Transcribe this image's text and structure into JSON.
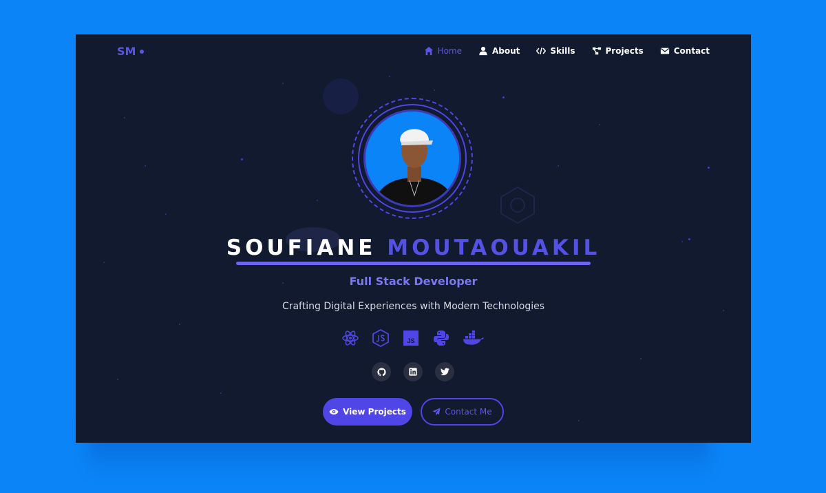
{
  "colors": {
    "page_bg": "#0a84f6",
    "frame_bg": "#111a2e",
    "accent": "#4f46e5",
    "accent_light": "#7c78f0"
  },
  "logo": {
    "text": "SM"
  },
  "nav": [
    {
      "label": "Home",
      "icon": "home-icon",
      "active": true
    },
    {
      "label": "About",
      "icon": "user-icon"
    },
    {
      "label": "Skills",
      "icon": "code-icon"
    },
    {
      "label": "Projects",
      "icon": "project-diagram-icon"
    },
    {
      "label": "Contact",
      "icon": "envelope-icon"
    }
  ],
  "hero": {
    "name_first": "SOUFIANE",
    "name_last": "MOUTAOUAKIL",
    "title": "Full Stack Developer",
    "tagline": "Crafting Digital Experiences with Modern Technologies"
  },
  "tech_icons": [
    "react-icon",
    "nodejs-icon",
    "javascript-icon",
    "python-icon",
    "docker-icon"
  ],
  "javascript_badge": "JS",
  "socials": [
    "github-icon",
    "linkedin-icon",
    "twitter-icon"
  ],
  "buttons": {
    "primary": "View Projects",
    "secondary": "Contact Me"
  }
}
